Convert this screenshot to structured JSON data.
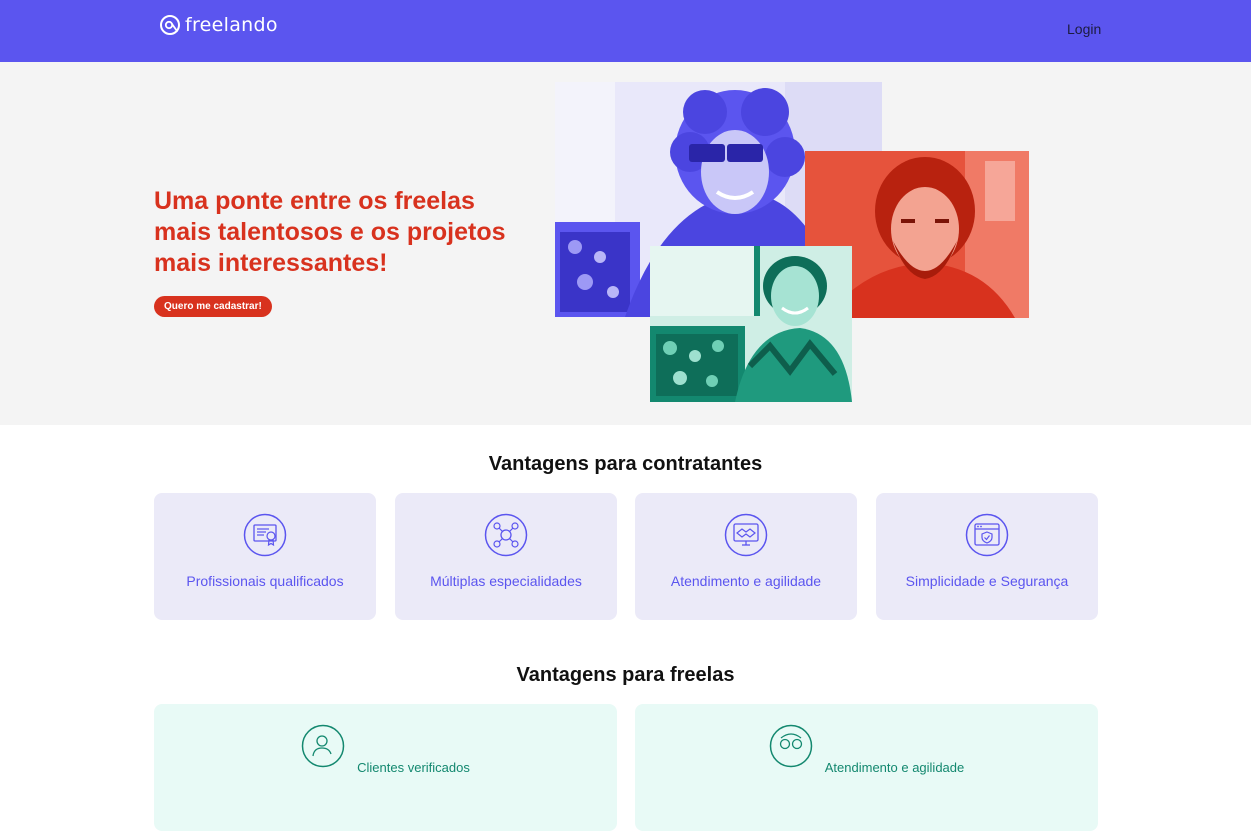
{
  "header": {
    "brand": "freelando",
    "login_label": "Login"
  },
  "hero": {
    "title": "Uma ponte entre os freelas mais talentosos e os projetos mais interessantes!",
    "cta_label": "Quero me cadastrar!"
  },
  "contratantes": {
    "title": "Vantagens para contratantes",
    "cards": [
      {
        "label": "Profissionais qualificados",
        "icon": "certificate-icon"
      },
      {
        "label": "Múltiplas especialidades",
        "icon": "network-icon"
      },
      {
        "label": "Atendimento e agilidade",
        "icon": "handshake-icon"
      },
      {
        "label": "Simplicidade e Segurança",
        "icon": "secure-browser-icon"
      }
    ]
  },
  "freelas": {
    "title": "Vantagens para freelas",
    "cards": [
      {
        "label": "Clientes verificados",
        "icon": "verified-user-icon"
      },
      {
        "label": "Atendimento e agilidade",
        "icon": "support-people-icon"
      }
    ]
  },
  "colors": {
    "brand": "#5b55ef",
    "accent_red": "#d8321e",
    "accent_green": "#13886f",
    "card_purple": "#ebeaf8",
    "card_mint": "#e8faf6"
  }
}
